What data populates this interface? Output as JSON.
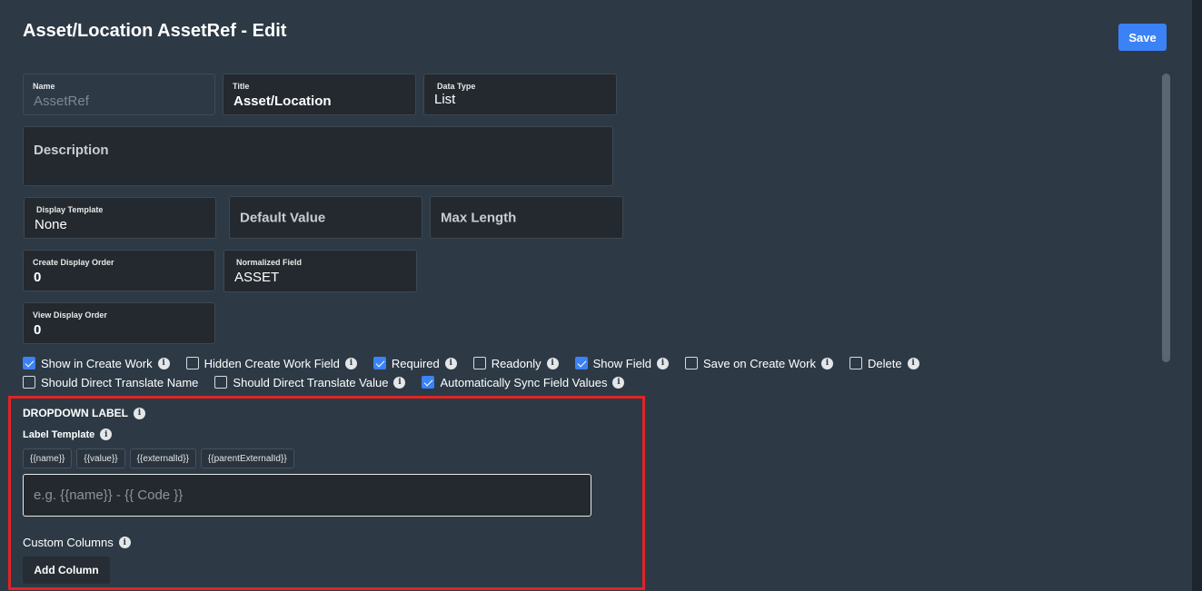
{
  "header": {
    "title": "Asset/Location AssetRef - Edit",
    "save_label": "Save"
  },
  "fields": {
    "name": {
      "label": "Name",
      "value": "AssetRef"
    },
    "title": {
      "label": "Title",
      "value": "Asset/Location"
    },
    "data_type": {
      "label": "Data Type",
      "value": "List"
    },
    "description": {
      "placeholder": "Description"
    },
    "display_template": {
      "label": "Display Template",
      "value": "None"
    },
    "default_value": {
      "placeholder": "Default Value"
    },
    "max_length": {
      "placeholder": "Max Length"
    },
    "create_display_order": {
      "label": "Create Display Order",
      "value": "0"
    },
    "normalized_field": {
      "label": "Normalized Field",
      "value": "ASSET"
    },
    "view_display_order": {
      "label": "View Display Order",
      "value": "0"
    }
  },
  "checkboxes_row1": [
    {
      "label": "Show in Create Work",
      "checked": true
    },
    {
      "label": "Hidden Create Work Field",
      "checked": false
    },
    {
      "label": "Required",
      "checked": true
    },
    {
      "label": "Readonly",
      "checked": false
    },
    {
      "label": "Show Field",
      "checked": true
    },
    {
      "label": "Save on Create Work",
      "checked": false
    },
    {
      "label": "Delete",
      "checked": false
    }
  ],
  "checkboxes_row2": [
    {
      "label": "Should Direct Translate Name",
      "checked": false
    },
    {
      "label": "Should Direct Translate Value",
      "checked": false
    },
    {
      "label": "Automatically Sync Field Values",
      "checked": true
    }
  ],
  "dropdown": {
    "section_title": "DROPDOWN LABEL",
    "label_template_title": "Label Template",
    "chips": [
      "{{name}}",
      "{{value}}",
      "{{externalId}}",
      "{{parentExternalId}}"
    ],
    "template_placeholder": "e.g. {{name}} - {{ Code }}",
    "custom_columns_title": "Custom Columns",
    "add_column_label": "Add Column"
  },
  "info_glyph": "i",
  "colors": {
    "accent": "#3b82f6",
    "panel": "#2d3a46",
    "highlight": "#e02424"
  }
}
